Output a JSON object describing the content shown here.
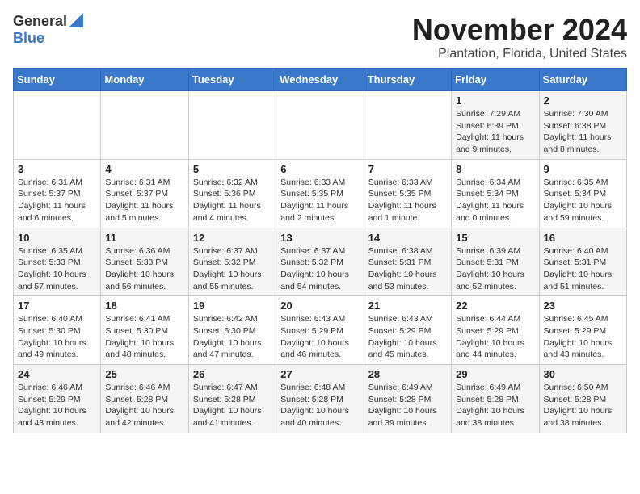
{
  "header": {
    "logo_general": "General",
    "logo_blue": "Blue",
    "month": "November 2024",
    "location": "Plantation, Florida, United States"
  },
  "days_of_week": [
    "Sunday",
    "Monday",
    "Tuesday",
    "Wednesday",
    "Thursday",
    "Friday",
    "Saturday"
  ],
  "weeks": [
    [
      {
        "day": "",
        "info": ""
      },
      {
        "day": "",
        "info": ""
      },
      {
        "day": "",
        "info": ""
      },
      {
        "day": "",
        "info": ""
      },
      {
        "day": "",
        "info": ""
      },
      {
        "day": "1",
        "info": "Sunrise: 7:29 AM\nSunset: 6:39 PM\nDaylight: 11 hours and 9 minutes."
      },
      {
        "day": "2",
        "info": "Sunrise: 7:30 AM\nSunset: 6:38 PM\nDaylight: 11 hours and 8 minutes."
      }
    ],
    [
      {
        "day": "3",
        "info": "Sunrise: 6:31 AM\nSunset: 5:37 PM\nDaylight: 11 hours and 6 minutes."
      },
      {
        "day": "4",
        "info": "Sunrise: 6:31 AM\nSunset: 5:37 PM\nDaylight: 11 hours and 5 minutes."
      },
      {
        "day": "5",
        "info": "Sunrise: 6:32 AM\nSunset: 5:36 PM\nDaylight: 11 hours and 4 minutes."
      },
      {
        "day": "6",
        "info": "Sunrise: 6:33 AM\nSunset: 5:35 PM\nDaylight: 11 hours and 2 minutes."
      },
      {
        "day": "7",
        "info": "Sunrise: 6:33 AM\nSunset: 5:35 PM\nDaylight: 11 hours and 1 minute."
      },
      {
        "day": "8",
        "info": "Sunrise: 6:34 AM\nSunset: 5:34 PM\nDaylight: 11 hours and 0 minutes."
      },
      {
        "day": "9",
        "info": "Sunrise: 6:35 AM\nSunset: 5:34 PM\nDaylight: 10 hours and 59 minutes."
      }
    ],
    [
      {
        "day": "10",
        "info": "Sunrise: 6:35 AM\nSunset: 5:33 PM\nDaylight: 10 hours and 57 minutes."
      },
      {
        "day": "11",
        "info": "Sunrise: 6:36 AM\nSunset: 5:33 PM\nDaylight: 10 hours and 56 minutes."
      },
      {
        "day": "12",
        "info": "Sunrise: 6:37 AM\nSunset: 5:32 PM\nDaylight: 10 hours and 55 minutes."
      },
      {
        "day": "13",
        "info": "Sunrise: 6:37 AM\nSunset: 5:32 PM\nDaylight: 10 hours and 54 minutes."
      },
      {
        "day": "14",
        "info": "Sunrise: 6:38 AM\nSunset: 5:31 PM\nDaylight: 10 hours and 53 minutes."
      },
      {
        "day": "15",
        "info": "Sunrise: 6:39 AM\nSunset: 5:31 PM\nDaylight: 10 hours and 52 minutes."
      },
      {
        "day": "16",
        "info": "Sunrise: 6:40 AM\nSunset: 5:31 PM\nDaylight: 10 hours and 51 minutes."
      }
    ],
    [
      {
        "day": "17",
        "info": "Sunrise: 6:40 AM\nSunset: 5:30 PM\nDaylight: 10 hours and 49 minutes."
      },
      {
        "day": "18",
        "info": "Sunrise: 6:41 AM\nSunset: 5:30 PM\nDaylight: 10 hours and 48 minutes."
      },
      {
        "day": "19",
        "info": "Sunrise: 6:42 AM\nSunset: 5:30 PM\nDaylight: 10 hours and 47 minutes."
      },
      {
        "day": "20",
        "info": "Sunrise: 6:43 AM\nSunset: 5:29 PM\nDaylight: 10 hours and 46 minutes."
      },
      {
        "day": "21",
        "info": "Sunrise: 6:43 AM\nSunset: 5:29 PM\nDaylight: 10 hours and 45 minutes."
      },
      {
        "day": "22",
        "info": "Sunrise: 6:44 AM\nSunset: 5:29 PM\nDaylight: 10 hours and 44 minutes."
      },
      {
        "day": "23",
        "info": "Sunrise: 6:45 AM\nSunset: 5:29 PM\nDaylight: 10 hours and 43 minutes."
      }
    ],
    [
      {
        "day": "24",
        "info": "Sunrise: 6:46 AM\nSunset: 5:29 PM\nDaylight: 10 hours and 43 minutes."
      },
      {
        "day": "25",
        "info": "Sunrise: 6:46 AM\nSunset: 5:28 PM\nDaylight: 10 hours and 42 minutes."
      },
      {
        "day": "26",
        "info": "Sunrise: 6:47 AM\nSunset: 5:28 PM\nDaylight: 10 hours and 41 minutes."
      },
      {
        "day": "27",
        "info": "Sunrise: 6:48 AM\nSunset: 5:28 PM\nDaylight: 10 hours and 40 minutes."
      },
      {
        "day": "28",
        "info": "Sunrise: 6:49 AM\nSunset: 5:28 PM\nDaylight: 10 hours and 39 minutes."
      },
      {
        "day": "29",
        "info": "Sunrise: 6:49 AM\nSunset: 5:28 PM\nDaylight: 10 hours and 38 minutes."
      },
      {
        "day": "30",
        "info": "Sunrise: 6:50 AM\nSunset: 5:28 PM\nDaylight: 10 hours and 38 minutes."
      }
    ]
  ]
}
